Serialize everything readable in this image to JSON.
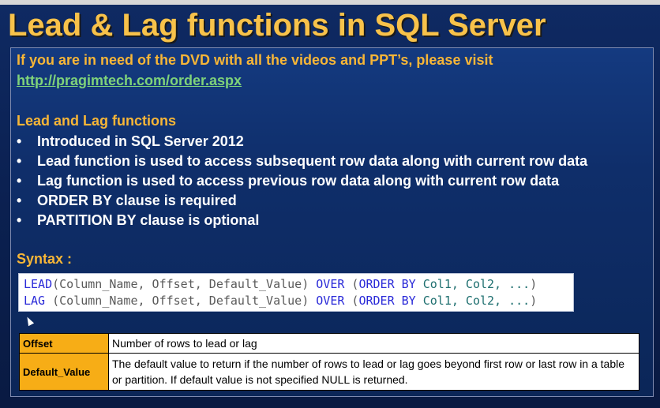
{
  "slide": {
    "title": "Lead & Lag functions in SQL Server",
    "dvd_text": "If you are in need of the DVD with all the videos and PPT’s, please visit",
    "dvd_link": "http://pragimtech.com/order.aspx",
    "section_heading": "Lead and Lag functions",
    "bullets": [
      "Introduced in SQL Server 2012",
      "Lead function is used to access subsequent row data along with current row data",
      "Lag function is used to access previous row data along with current row data",
      "ORDER BY clause is required",
      "PARTITION BY clause is optional"
    ],
    "bullet_symbol": "•",
    "syntax_heading": "Syntax :"
  },
  "code": {
    "line1": {
      "fn": "LEAD",
      "args": "(Column_Name, Offset, Default_Value)",
      "over": "OVER",
      "paren_open": "(",
      "order_by": "ORDER BY",
      "cols": "Col1, Col2, ...",
      "paren_close": ")"
    },
    "line2": {
      "fn": "LAG ",
      "args": "(Column_Name, Offset, Default_Value)",
      "over": "OVER",
      "paren_open": "(",
      "order_by": "ORDER BY",
      "cols": "Col1, Col2, ...",
      "paren_close": ")"
    }
  },
  "params_table": {
    "rows": [
      {
        "name": "Offset",
        "description": "Number of rows to lead or lag"
      },
      {
        "name": "Default_Value",
        "description": "The default value to return if the number of rows to lead or lag goes beyond first row or last row in a table or partition. If default value is not specified NULL is returned."
      }
    ]
  },
  "colors": {
    "title": "#f8c24a",
    "heading": "#f7b637",
    "link": "#7fd37a",
    "keyword": "#2a2ad8",
    "code_text": "#1e6f6f",
    "param_name_bg": "#f7ad16",
    "background": "#0b2152"
  }
}
